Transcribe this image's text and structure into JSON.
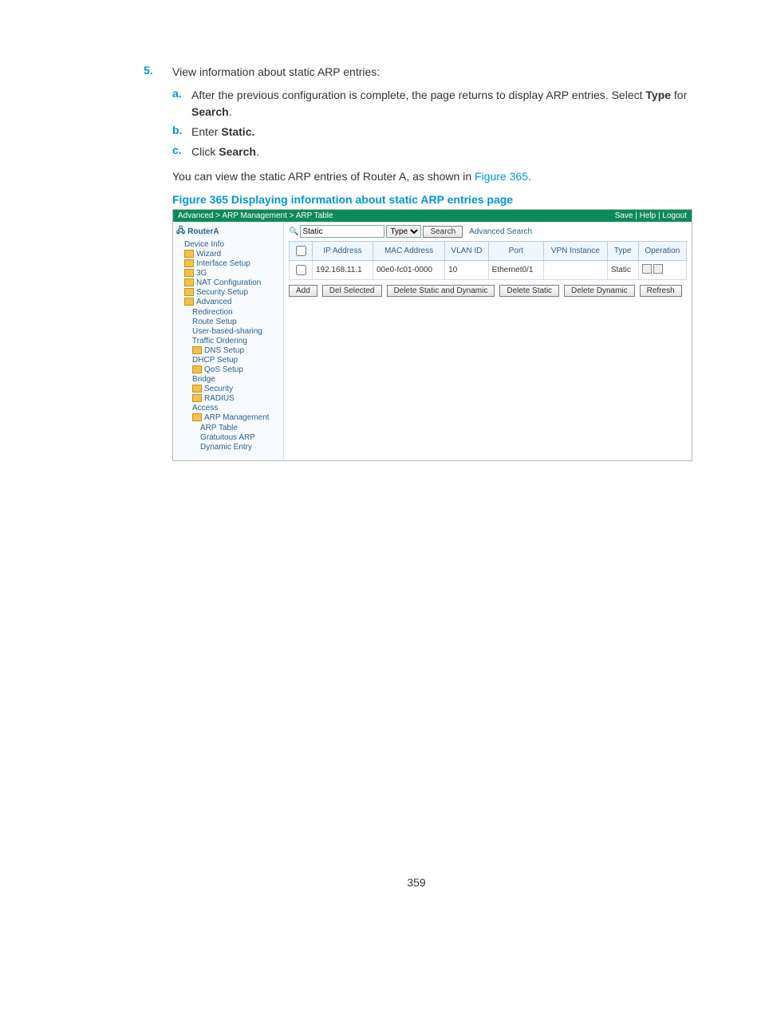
{
  "step": {
    "number": "5.",
    "text": "View information about static ARP entries:"
  },
  "substeps": {
    "a": {
      "letter": "a.",
      "text_before": "After the previous configuration is complete, the page returns to display ARP entries. Select ",
      "bold1": "Type",
      "mid": " for ",
      "bold2": "Search",
      "after": "."
    },
    "b": {
      "letter": "b.",
      "text": "Enter ",
      "bold": "Static."
    },
    "c": {
      "letter": "c.",
      "text": "Click ",
      "bold": "Search",
      "after": "."
    }
  },
  "note": {
    "before": "You can view the static ARP entries of Router A, as shown in ",
    "link": "Figure 365",
    "after": "."
  },
  "figcap": "Figure 365 Displaying information about static ARP entries page",
  "shot": {
    "breadcrumb": "Advanced > ARP Management > ARP Table",
    "toplinks": "Save | Help | Logout",
    "root": "RouterA",
    "side": [
      "Device Info",
      "Wizard",
      "Interface Setup",
      "3G",
      "NAT Configuration",
      "Security Setup",
      "Advanced",
      "Redirection",
      "Route Setup",
      "User-based-sharing",
      "Traffic Ordering",
      "DNS Setup",
      "DHCP Setup",
      "QoS Setup",
      "Bridge",
      "Security",
      "RADIUS",
      "Access",
      "ARP Management",
      "ARP Table",
      "Gratuitous ARP",
      "Dynamic Entry"
    ],
    "search": {
      "value": "Static",
      "select": "Type",
      "btn": "Search",
      "adv": "Advanced Search"
    },
    "cols": [
      "IP Address",
      "MAC Address",
      "VLAN ID",
      "Port",
      "VPN Instance",
      "Type",
      "Operation"
    ],
    "row": {
      "ip": "192.168.11.1",
      "mac": "00e0-fc01-0000",
      "vlan": "10",
      "port": "Ethernet0/1",
      "vpn": "",
      "type": "Static"
    },
    "btns": [
      "Add",
      "Del Selected",
      "Delete Static and Dynamic",
      "Delete Static",
      "Delete Dynamic",
      "Refresh"
    ]
  },
  "pagenum": "359"
}
